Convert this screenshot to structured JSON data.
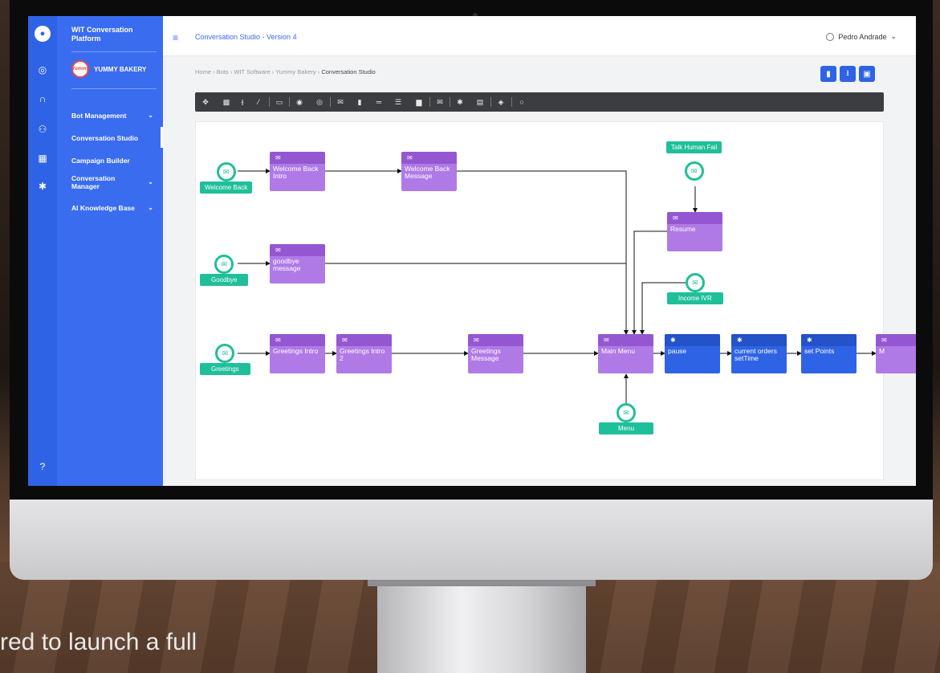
{
  "caption": "red to launch a full",
  "app": {
    "platform_name": "WIT Conversation Platform",
    "brand": "YUMMY BAKERY",
    "brand_logo_text": "Yummy",
    "title": "Conversation Studio - Version 4",
    "user": "Pedro Andrade"
  },
  "rail_icons": [
    "app-logo-icon",
    "target-icon",
    "headset-icon",
    "users-icon",
    "building-icon",
    "gear-icon"
  ],
  "sidebar": {
    "items": [
      {
        "label": "Bot Management",
        "chevron": true
      },
      {
        "label": "Conversation Studio",
        "chevron": false,
        "active": true
      },
      {
        "label": "Campaign Builder",
        "chevron": false
      },
      {
        "label": "Conversation Manager",
        "chevron": true
      },
      {
        "label": "AI Knowledge Base",
        "chevron": true
      }
    ]
  },
  "breadcrumb": {
    "items": [
      "Home",
      "Bots",
      "WIT Software",
      "Yummy Bakery"
    ],
    "current": "Conversation Studio"
  },
  "toolbar_icons": [
    "move-icon",
    "qr-icon",
    "split-icon",
    "wand-icon",
    "window-icon",
    "radio-icon",
    "target-icon",
    "mail-icon",
    "card-icon",
    "divider-icon",
    "list-icon",
    "image-icon",
    "envelope-icon",
    "gear-icon",
    "template-icon",
    "diamond-icon",
    "circle-icon"
  ],
  "flow": {
    "triggers": [
      {
        "label": "Welcome Back"
      },
      {
        "label": "Goodbye"
      },
      {
        "label": "Greetings"
      },
      {
        "label": "Talk Human Fail"
      },
      {
        "label": "Income IVR"
      },
      {
        "label": "Menu"
      }
    ],
    "nodes": [
      {
        "label": "Welcome Back Intro",
        "kind": "message"
      },
      {
        "label": "Welcome Back Message",
        "kind": "message"
      },
      {
        "label": "goodbye message",
        "kind": "message"
      },
      {
        "label": "Resume",
        "kind": "message"
      },
      {
        "label": "Greetings Intro",
        "kind": "message"
      },
      {
        "label": "Greetings Intro 2",
        "kind": "message"
      },
      {
        "label": "Greetings Message",
        "kind": "message"
      },
      {
        "label": "Main Menu",
        "kind": "message"
      },
      {
        "label": "pause",
        "kind": "action"
      },
      {
        "label": "current orders setTime",
        "kind": "action"
      },
      {
        "label": "set Points",
        "kind": "action"
      },
      {
        "label": "M",
        "kind": "message"
      }
    ]
  },
  "zoom_icons": [
    "zoom-out-icon",
    "zoom-in-icon",
    "zoom-reset-icon",
    "fit-icon",
    "fullscreen-icon"
  ],
  "colors": {
    "primary": "#3a6cf0",
    "message_node": "#b07ae6",
    "action_node": "#2f63e6",
    "trigger": "#1fbf9a"
  }
}
